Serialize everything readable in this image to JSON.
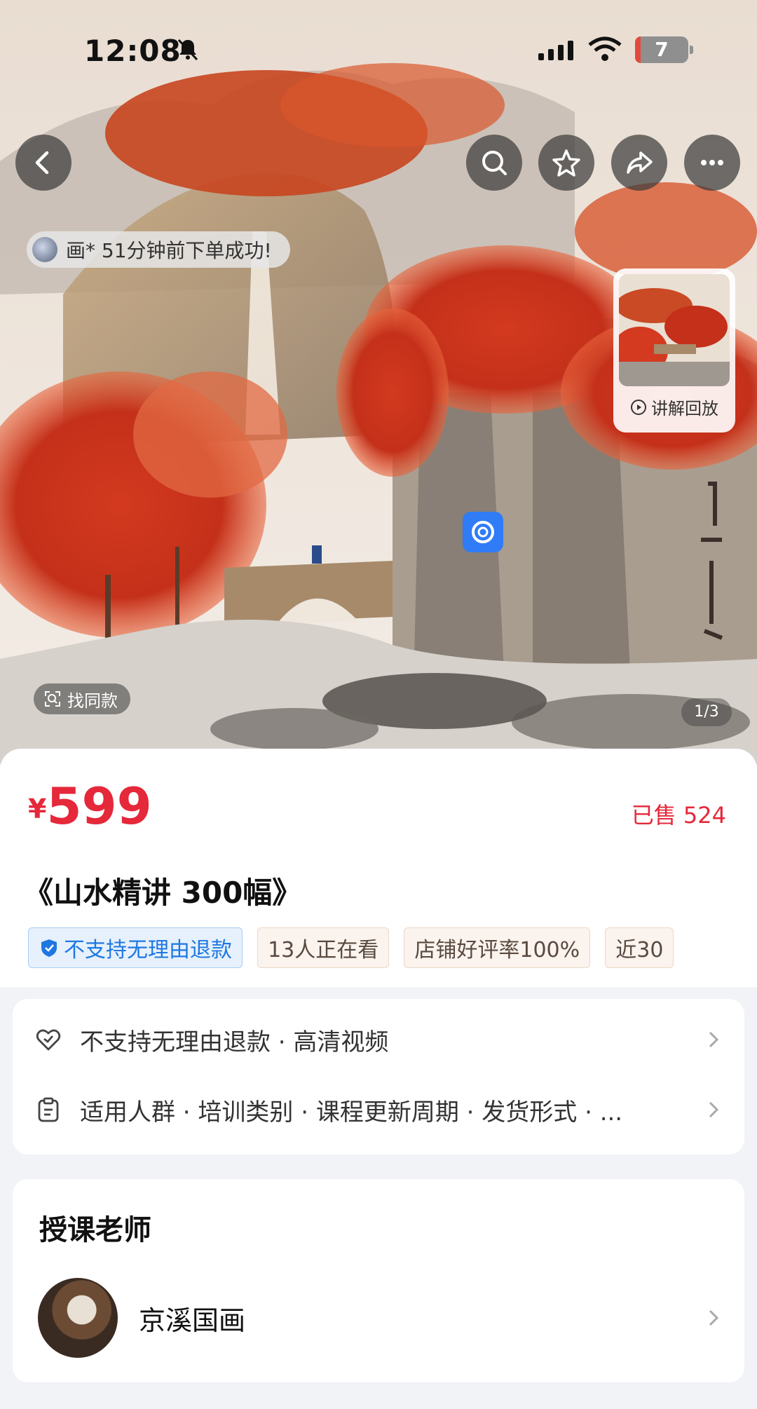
{
  "status_bar": {
    "time": "12:08",
    "battery": "7"
  },
  "nav": {
    "back_icon": "chevron-left-icon",
    "search_icon": "search-icon",
    "favorite_icon": "star-icon",
    "share_icon": "share-icon",
    "more_icon": "more-icon"
  },
  "hero": {
    "order_toast": "画* 51分钟前下单成功!",
    "replay_label": "讲解回放",
    "find_same_label": "找同款",
    "page_indicator": "1/3"
  },
  "product": {
    "currency": "¥",
    "price": "599",
    "sold": "已售 524",
    "title": "《山水精讲 300幅》",
    "tags": [
      {
        "label": "不支持无理由退款",
        "style": "blue"
      },
      {
        "label": "13人正在看",
        "style": "plain"
      },
      {
        "label": "店铺好评率100%",
        "style": "plain"
      },
      {
        "label": "近30",
        "style": "plain"
      }
    ]
  },
  "info": {
    "row1": "不支持无理由退款 · 高清视频",
    "row2": "适用人群 · 培训类别 · 课程更新周期 · 发货形式 · ..."
  },
  "teacher": {
    "heading": "授课老师",
    "name": "京溪国画"
  },
  "colors": {
    "price_red": "#e5283a",
    "tag_blue": "#1f78e0",
    "page_bg": "#f2f3f7"
  }
}
